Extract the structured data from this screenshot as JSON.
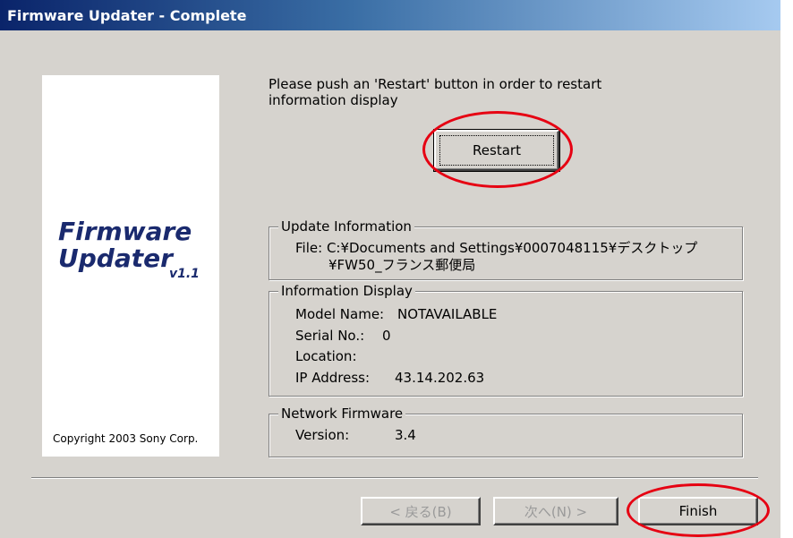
{
  "window": {
    "title": "Firmware Updater - Complete"
  },
  "logo": {
    "line1": "Firmware",
    "line2": "Updater",
    "version": "v1.1",
    "copyright": "Copyright 2003 Sony Corp."
  },
  "instruction": "Please push an 'Restart' button in order to restart information display",
  "buttons": {
    "restart": "Restart",
    "back": "< 戻る(B)",
    "next": "次へ(N) >",
    "finish": "Finish"
  },
  "update_info": {
    "legend": "Update Information",
    "file_label": "File:",
    "file_line1": "C:¥Documents and Settings¥0007048115¥デスクトップ",
    "file_line2": "¥FW50_フランス郵便局"
  },
  "info_display": {
    "legend": "Information Display",
    "model_label": "Model Name:",
    "model_value": "NOTAVAILABLE",
    "serial_label": "Serial No.:",
    "serial_value": "0",
    "location_label": "Location:",
    "location_value": "",
    "ip_label": "IP Address:",
    "ip_value": "43.14.202.63"
  },
  "network_firmware": {
    "legend": "Network Firmware",
    "version_label": "Version:",
    "version_value": "3.4"
  },
  "colors": {
    "dialog_bg": "#d6d3ce",
    "titlebar_start": "#0a246a",
    "titlebar_end": "#a6caf0",
    "highlight": "#e60012",
    "logo_text": "#1a2a6e"
  }
}
